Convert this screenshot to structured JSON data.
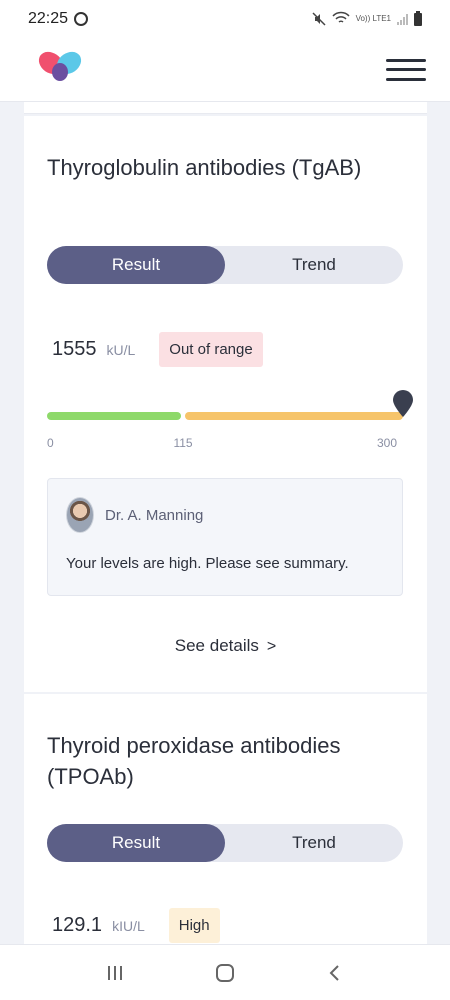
{
  "status_bar": {
    "time": "22:25",
    "network_label": "Vo)) LTE1"
  },
  "header": {
    "logo_colors": [
      "#f0506e",
      "#5bc8e8",
      "#6b4fa0"
    ]
  },
  "tests": [
    {
      "title": "Thyroglobulin antibodies (TgAB)",
      "tabs": [
        {
          "label": "Result",
          "active": true
        },
        {
          "label": "Trend",
          "active": false
        }
      ],
      "value": "1555",
      "unit": "kU/L",
      "range_status": "Out of range",
      "scale": {
        "ticks": [
          "0",
          "115",
          "300"
        ],
        "normal_max": 115,
        "scale_max": 300,
        "marker_value": 300
      },
      "doctor": {
        "name": "Dr. A. Manning",
        "message": "Your levels are high.  Please see summary."
      },
      "details_label": "See details"
    },
    {
      "title": "Thyroid peroxidase antibodies (TPOAb)",
      "tabs": [
        {
          "label": "Result",
          "active": true
        },
        {
          "label": "Trend",
          "active": false
        }
      ],
      "value": "129.1",
      "unit": "kIU/L",
      "range_status": "High"
    }
  ],
  "colors": {
    "primary": "#5c5f87",
    "range_normal": "#8ed96a",
    "range_high": "#f6c46a",
    "badge_out": "#fbe0e3",
    "badge_high": "#fdf0d8"
  },
  "nav": {
    "buttons": [
      "recent-apps-icon",
      "home-icon",
      "back-icon"
    ]
  }
}
